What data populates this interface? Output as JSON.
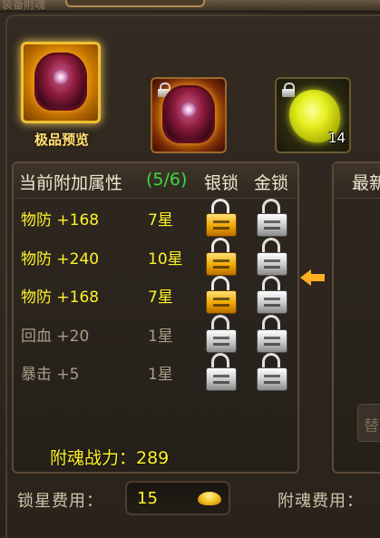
{
  "top_bar": {
    "partial_text": "装备附魂"
  },
  "items": {
    "preview_label": "极品预览",
    "stone_count": "14"
  },
  "panel": {
    "title": "当前附加属性",
    "count": "(5/6)",
    "silver_lock_header": "银锁",
    "gold_lock_header": "金锁",
    "rows": [
      {
        "attr": "物防 +168",
        "stars": "7星",
        "active": true,
        "silver_lock": "gold-lock-icon",
        "gold_lock": "silver-lock-icon"
      },
      {
        "attr": "物防 +240",
        "stars": "10星",
        "active": true,
        "silver_lock": "gold-lock-icon",
        "gold_lock": "silver-lock-icon"
      },
      {
        "attr": "物防 +168",
        "stars": "7星",
        "active": true,
        "silver_lock": "gold-lock-icon",
        "gold_lock": "silver-lock-icon"
      },
      {
        "attr": "回血 +20",
        "stars": "1星",
        "active": false,
        "silver_lock": "silver-lock-icon",
        "gold_lock": "silver-lock-icon"
      },
      {
        "attr": "暴击 +5",
        "stars": "1星",
        "active": false,
        "silver_lock": "silver-lock-icon",
        "gold_lock": "silver-lock-icon"
      }
    ],
    "power": "附魂战力：289"
  },
  "right_panel": {
    "title": "最新",
    "button_partial": "替"
  },
  "footer": {
    "lock_fee_label": "锁星费用：",
    "lock_fee_value": "15",
    "fuhun_fee_label": "附魂费用："
  },
  "colors": {
    "active_text": "#fff22a",
    "inactive_text": "#a89d86",
    "count_green": "#3fd840",
    "arrow": "#ffb020"
  }
}
